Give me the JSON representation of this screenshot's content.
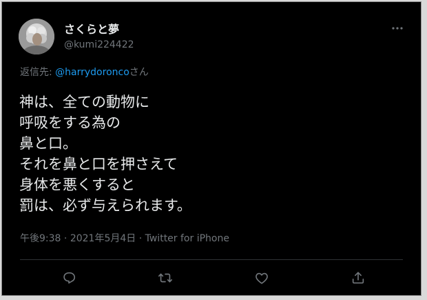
{
  "tweet": {
    "display_name": "さくらと夢",
    "handle": "@kumi224422",
    "reply_prefix": "返信先: ",
    "reply_mention": "@harrydoronco",
    "reply_suffix": "さん",
    "lines": [
      "神は、全ての動物に",
      "呼吸をする為の",
      "鼻と口。",
      "それを鼻と口を押さえて",
      "身体を悪くすると",
      "罰は、必ず与えられます。"
    ],
    "time": "午後9:38",
    "separator1": " · ",
    "date": "2021年5月4日",
    "separator2": " · ",
    "source": "Twitter for iPhone"
  },
  "icons": {
    "more": "more-horizontal-icon",
    "reply": "reply-icon",
    "retweet": "retweet-icon",
    "like": "heart-icon",
    "share": "share-icon"
  },
  "colors": {
    "background": "#000000",
    "text": "#e7e9ea",
    "secondary": "#71767b",
    "accent": "#1d9bf0",
    "divider": "#2f3336"
  }
}
